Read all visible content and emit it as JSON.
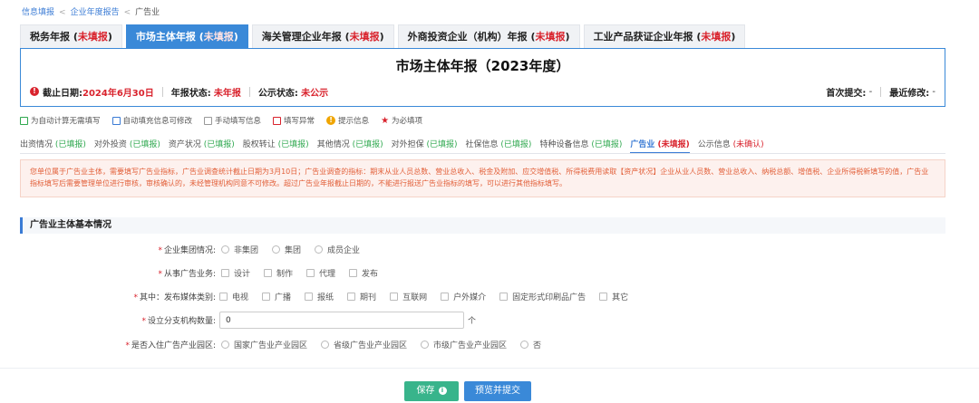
{
  "breadcrumb": [
    "信息填报",
    "企业年度报告",
    "广告业"
  ],
  "tabs": [
    {
      "label": "税务年报",
      "status": "未填报"
    },
    {
      "label": "市场主体年报",
      "status": "未填报"
    },
    {
      "label": "海关管理企业年报",
      "status": "未填报"
    },
    {
      "label": "外商投资企业（机构）年报",
      "status": "未填报"
    },
    {
      "label": "工业产品获证企业年报",
      "status": "未填报"
    }
  ],
  "report": {
    "title": "市场主体年报（2023年度）",
    "deadline_label": "截止日期:",
    "deadline_value": "2024年6月30日",
    "status_label": "年报状态:",
    "status_value": "未年报",
    "public_label": "公示状态:",
    "public_value": "未公示",
    "first_submit_label": "首次提交:",
    "first_submit_value": "-",
    "last_modify_label": "最近修改:",
    "last_modify_value": "-"
  },
  "legend": [
    "为自动计算无需填写",
    "自动填充信息可修改",
    "手动填写信息",
    "填写异常",
    "提示信息",
    "为必填项"
  ],
  "subnav": [
    {
      "label": "出资情况",
      "status": "(已填报)"
    },
    {
      "label": "对外投资",
      "status": "(已填报)"
    },
    {
      "label": "资产状况",
      "status": "(已填报)"
    },
    {
      "label": "股权转让",
      "status": "(已填报)"
    },
    {
      "label": "其他情况",
      "status": "(已填报)"
    },
    {
      "label": "对外担保",
      "status": "(已填报)"
    },
    {
      "label": "社保信息",
      "status": "(已填报)"
    },
    {
      "label": "特种设备信息",
      "status": "(已填报)"
    },
    {
      "label": "广告业",
      "status": "(未填报)"
    },
    {
      "label": "公示信息",
      "status": "(未确认)"
    }
  ],
  "notice": "您单位属于广告业主体，需要填写广告业指标，广告业调查统计截止日期为3月10日；广告业调查的指标：期末从业人员总数、营业总收入、税金及附加、应交增值税、所得税费用读取【资产状况】企业从业人员数、营业总收入、纳税总额、增值税、企业所得税新填写的值，广告业指标填写后需要管理单位进行审核，审核确认的，未经管理机构同意不可修改。超过广告业年报截止日期的，不能进行报送广告业指标的填写，可以进行其他指标填写。",
  "section_title": "广告业主体基本情况",
  "form": {
    "group_label": "企业集团情况:",
    "group_options": [
      "非集团",
      "集团",
      "成员企业"
    ],
    "business_label": "从事广告业务:",
    "business_options": [
      "设计",
      "制作",
      "代理",
      "发布"
    ],
    "media_label": "其中：发布媒体类别:",
    "media_options": [
      "电视",
      "广播",
      "报纸",
      "期刊",
      "互联网",
      "户外媒介",
      "固定形式印刷品广告",
      "其它"
    ],
    "branch_label": "设立分支机构数量:",
    "branch_value": "0",
    "branch_unit": "个",
    "park_label": "是否入住广告产业园区:",
    "park_options": [
      "国家广告业产业园区",
      "省级广告业产业园区",
      "市级广告业产业园区",
      "否"
    ]
  },
  "buttons": {
    "save": "保存",
    "submit": "预览并提交"
  },
  "colors": {
    "accent": "#3a89d8",
    "required": "#d9232d",
    "filled": "#2fa84f",
    "save": "#38b48b"
  }
}
